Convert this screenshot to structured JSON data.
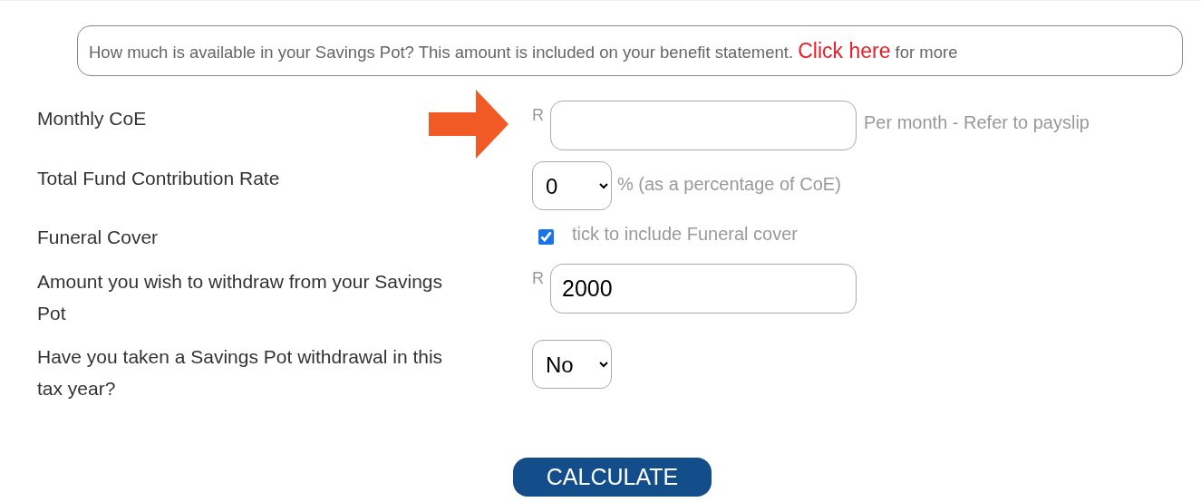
{
  "info_banner": {
    "text": "How much is available in your Savings Pot? This amount is included on your benefit statement.",
    "link": "Click here",
    "suffix": "for more"
  },
  "fields": [
    {
      "kind": "text",
      "label": "Monthly CoE",
      "prefix": "R",
      "hint": "Per month - Refer to payslip"
    },
    {
      "kind": "select",
      "label": "Total Fund Contribution Rate",
      "value": "0",
      "hint": "% (as a percentage of CoE)"
    },
    {
      "kind": "checkbox",
      "label": "Funeral Cover",
      "checked": true,
      "hint": "tick to include Funeral cover"
    },
    {
      "kind": "text",
      "label": "Amount you wish to withdraw from your Savings Pot",
      "prefix": "R",
      "value": "2000"
    },
    {
      "kind": "select",
      "label": "Have you taken a Savings Pot withdrawal in this tax year?",
      "value": "No"
    }
  ],
  "button": "CALCULATE"
}
